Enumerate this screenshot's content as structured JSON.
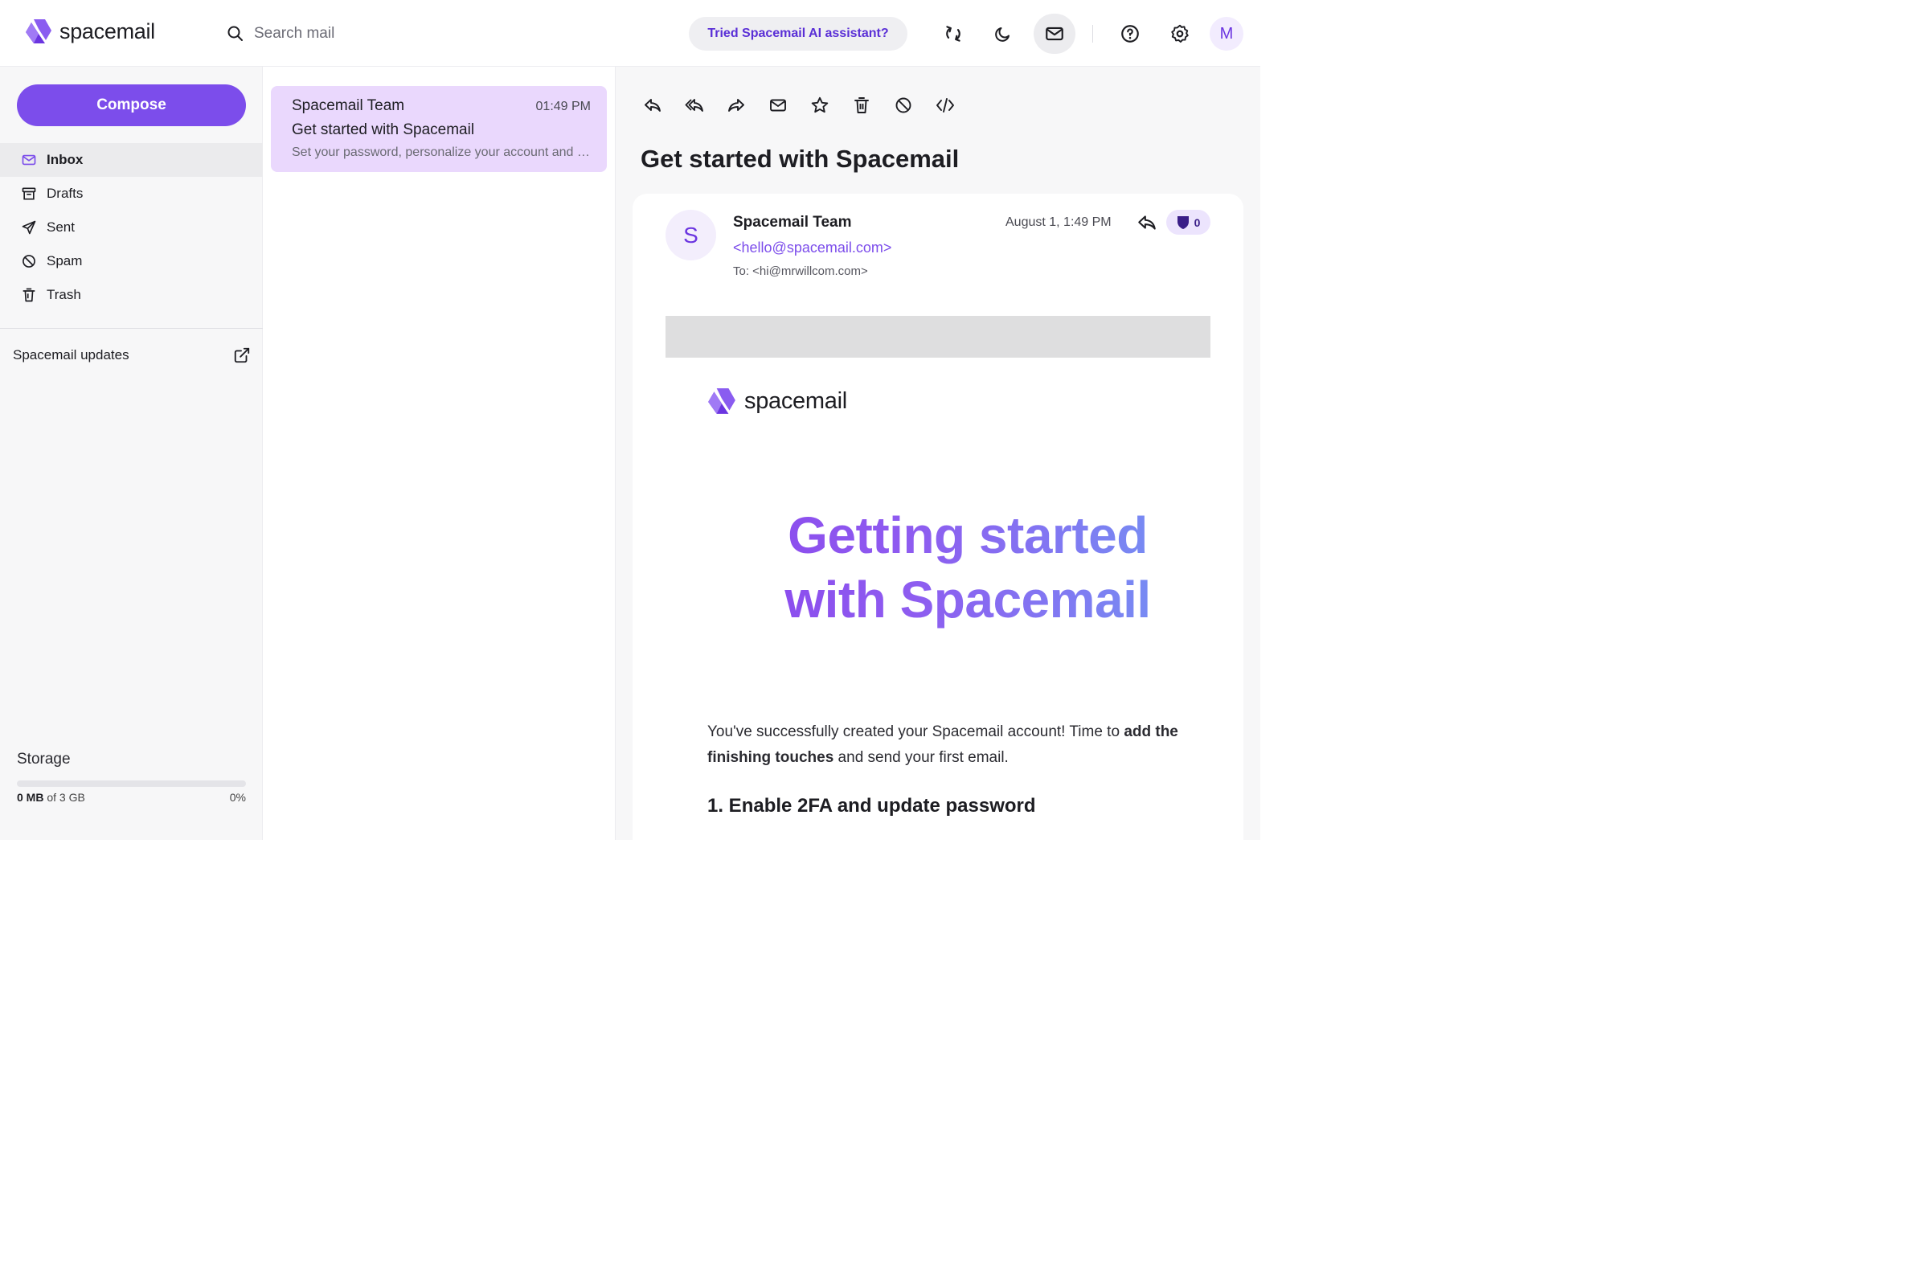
{
  "header": {
    "logo_prefix": "space",
    "logo_suffix": "mail",
    "search_placeholder": "Search mail",
    "ai_prompt": "Tried Spacemail AI assistant?",
    "avatar_initial": "M"
  },
  "sidebar": {
    "compose_label": "Compose",
    "items": [
      {
        "label": "Inbox",
        "icon": "inbox-icon",
        "active": true
      },
      {
        "label": "Drafts",
        "icon": "drafts-icon"
      },
      {
        "label": "Sent",
        "icon": "sent-icon"
      },
      {
        "label": "Spam",
        "icon": "spam-icon"
      },
      {
        "label": "Trash",
        "icon": "trash-icon"
      }
    ],
    "updates_label": "Spacemail updates",
    "storage": {
      "title": "Storage",
      "used": "0 MB",
      "of_total": "of 3 GB",
      "percent_label": "0%",
      "percent_value": 0
    }
  },
  "message_list": [
    {
      "from": "Spacemail Team",
      "time": "01:49 PM",
      "subject": "Get started with Spacemail",
      "snippet": "Set your password, personalize your account and send your first email"
    }
  ],
  "reader": {
    "subject": "Get started with Spacemail",
    "sender_initial": "S",
    "sender_name": "Spacemail Team",
    "sender_email": "<hello@spacemail.com>",
    "to_line": "To: <hi@mrwillcom.com>",
    "date": "August 1, 1:49 PM",
    "shield_count": "0",
    "email_logo_prefix": "space",
    "email_logo_suffix": "mail",
    "hero_line1": "Getting started",
    "hero_line2": "with Spacemail",
    "body_part1": "You've successfully created your Spacemail account! Time to ",
    "body_bold1": "add the",
    "body_bold2": "finishing touches",
    "body_part2": " and send your first email.",
    "section_heading": "1. Enable 2FA and update password"
  },
  "colors": {
    "accent": "#7c4deb",
    "selected_message_bg": "#ead8fd",
    "ai_pill_text": "#5a2fd6"
  }
}
